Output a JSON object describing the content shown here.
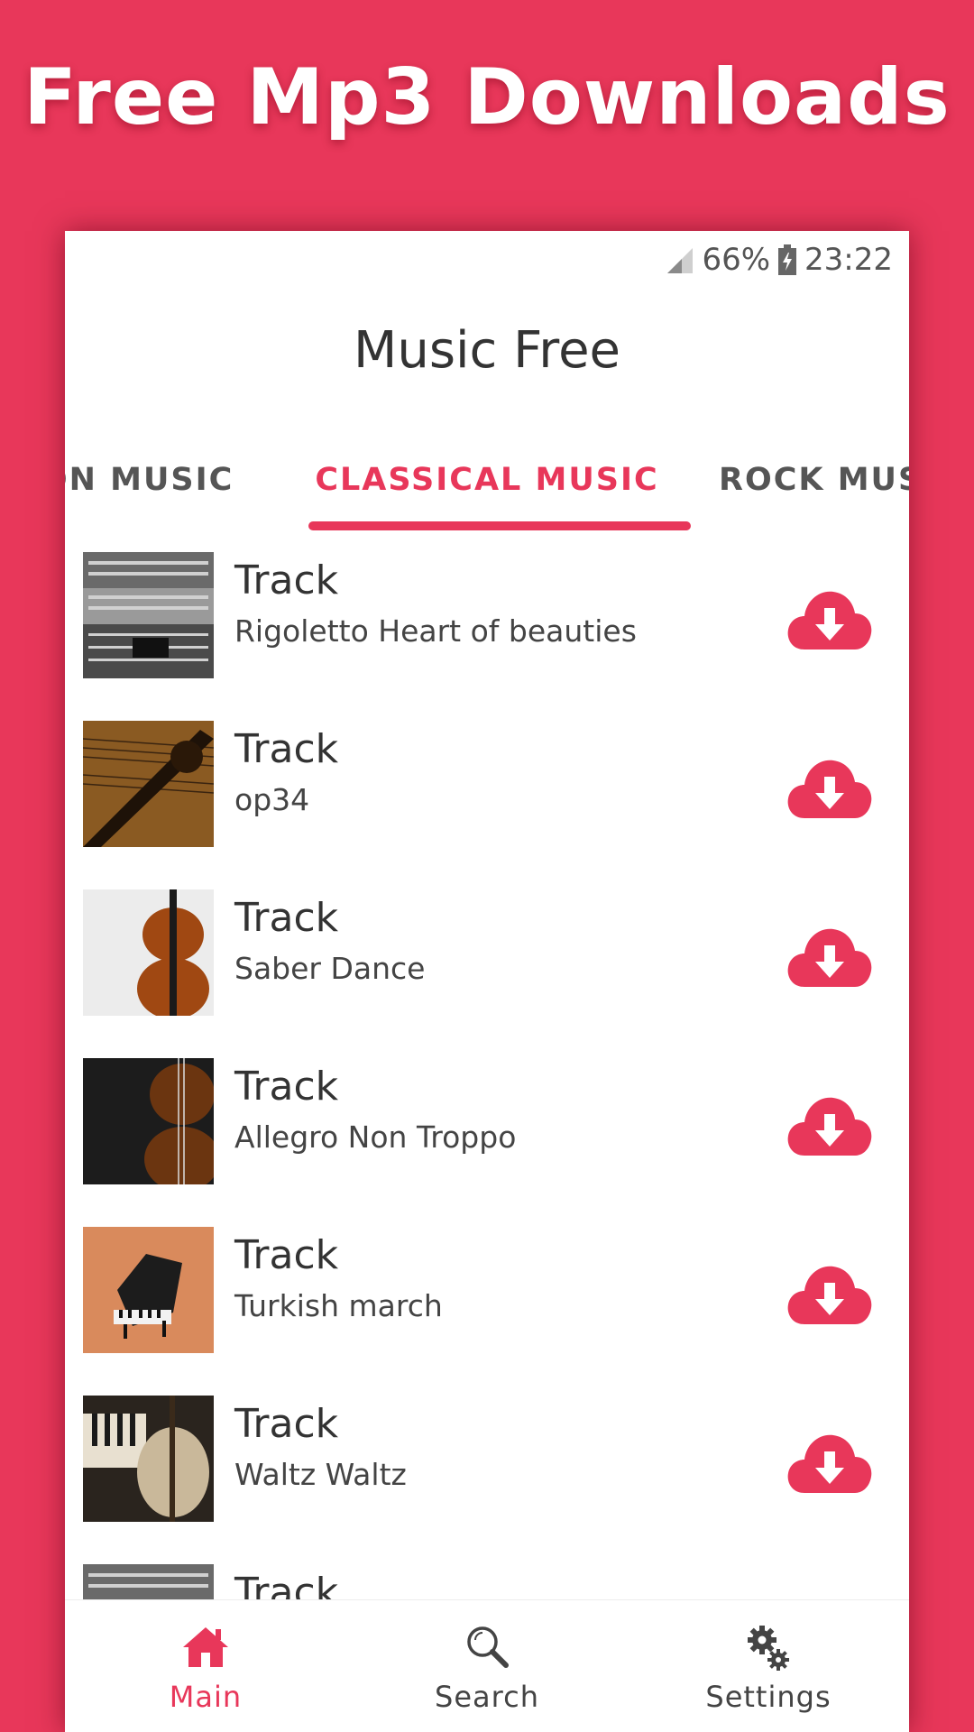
{
  "promo": {
    "title": "Free Mp3 Downloads"
  },
  "status_bar": {
    "battery": "66%",
    "time": "23:22"
  },
  "app": {
    "title": "Music Free"
  },
  "tabs": [
    {
      "label": "TION MUSIC"
    },
    {
      "label": "CLASSICAL MUSIC",
      "active": true
    },
    {
      "label": "ROCK MUS"
    }
  ],
  "tracks": [
    {
      "title": "Track",
      "subtitle": "Rigoletto Heart of beauties",
      "thumb": "concert-hall"
    },
    {
      "title": "Track",
      "subtitle": "op34",
      "thumb": "violin-sheet-music"
    },
    {
      "title": "Track",
      "subtitle": "Saber Dance",
      "thumb": "violin-white"
    },
    {
      "title": "Track",
      "subtitle": "Allegro Non Troppo",
      "thumb": "violin-dark"
    },
    {
      "title": "Track",
      "subtitle": "Turkish march",
      "thumb": "grand-piano"
    },
    {
      "title": "Track",
      "subtitle": "Waltz Waltz",
      "thumb": "piano-violin"
    },
    {
      "title": "Track",
      "subtitle": "",
      "thumb": "concert-hall"
    }
  ],
  "bottom_nav": [
    {
      "label": "Main",
      "icon": "home-icon",
      "active": true
    },
    {
      "label": "Search",
      "icon": "search-icon"
    },
    {
      "label": "Settings",
      "icon": "settings-gear-icon"
    }
  ],
  "colors": {
    "accent": "#e8375a",
    "text": "#333333"
  }
}
